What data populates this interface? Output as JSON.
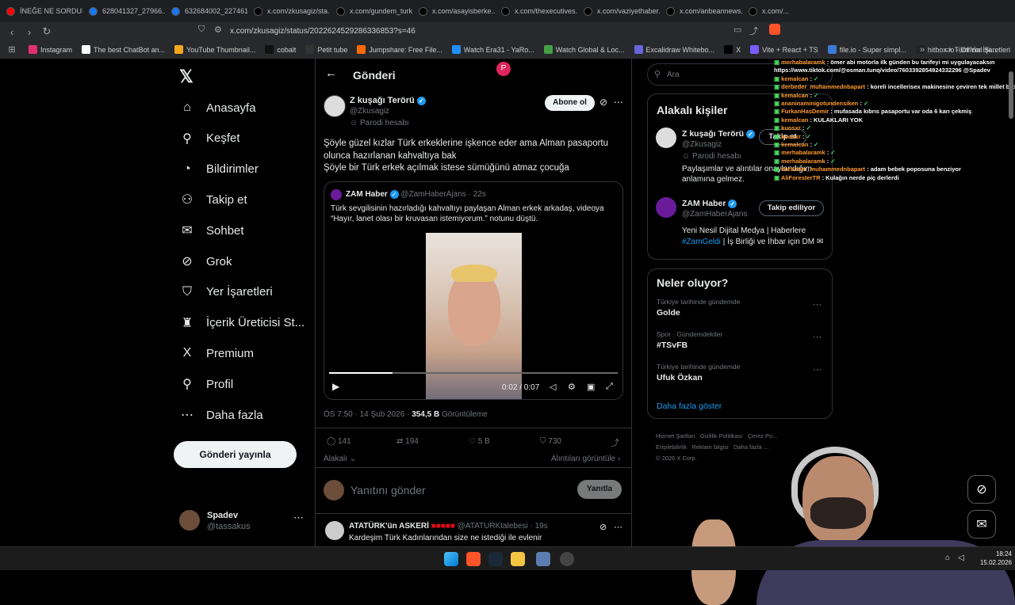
{
  "tabs": [
    {
      "label": "İNEĞE NE SORDUN",
      "color": "#ff0000"
    },
    {
      "label": "628041327_27966...",
      "color": "#1877f2"
    },
    {
      "label": "632684002_227461...",
      "color": "#1877f2"
    },
    {
      "label": "x.com/zkusagiz/sta...",
      "color": "#000000"
    },
    {
      "label": "x.com/gundem_turk...",
      "color": "#000000"
    },
    {
      "label": "x.com/asayisberke...",
      "color": "#000000"
    },
    {
      "label": "x.com/thexecutives...",
      "color": "#000000"
    },
    {
      "label": "x.com/vaziyethaber...",
      "color": "#000000"
    },
    {
      "label": "x.com/anbeannews...",
      "color": "#000000"
    },
    {
      "label": "x.com/...",
      "color": "#000000"
    }
  ],
  "address": {
    "url": "x.com/zkusagiz/status/2022624529286336853?s=46"
  },
  "bookmarks": [
    {
      "label": "Instagram",
      "color": "#e1306c"
    },
    {
      "label": "The best ChatBot an...",
      "color": "#ffffff"
    },
    {
      "label": "YouTube Thumbnail...",
      "color": "#f4a61d"
    },
    {
      "label": "cobalt",
      "color": "#111111"
    },
    {
      "label": "Petit tube",
      "color": "#333333"
    },
    {
      "label": "Jumpshare: Free File...",
      "color": "#ff6a00"
    },
    {
      "label": "Watch Era31 - YaRo...",
      "color": "#1e90ff"
    },
    {
      "label": "Watch Global & Loc...",
      "color": "#43a047"
    },
    {
      "label": "Excalidraw Whitebo...",
      "color": "#6965db"
    },
    {
      "label": "X",
      "color": "#000000"
    },
    {
      "label": "Vite + React + TS",
      "color": "#7a5cff"
    },
    {
      "label": "file.io - Super simpl...",
      "color": "#3a7bd5"
    },
    {
      "label": "hitbox.io - Official Si...",
      "color": "#222222"
    }
  ],
  "bookmarks_all": "Tüm Yer İşaretleri",
  "nav": {
    "items": [
      {
        "label": "Anasayfa",
        "icon": "home-icon",
        "glyph": "⌂"
      },
      {
        "label": "Keşfet",
        "icon": "search-icon",
        "glyph": "⚲"
      },
      {
        "label": "Bildirimler",
        "icon": "bell-icon",
        "glyph": "◔"
      },
      {
        "label": "Takip et",
        "icon": "follow-icon",
        "glyph": "⚇"
      },
      {
        "label": "Sohbet",
        "icon": "mail-icon",
        "glyph": "✉"
      },
      {
        "label": "Grok",
        "icon": "grok-icon",
        "glyph": "⊘"
      },
      {
        "label": "Yer İşaretleri",
        "icon": "bookmark-icon",
        "glyph": "⛉"
      },
      {
        "label": "İçerik Üreticisi St...",
        "icon": "creator-icon",
        "glyph": "♜"
      },
      {
        "label": "Premium",
        "icon": "x-premium-icon",
        "glyph": "X"
      },
      {
        "label": "Profil",
        "icon": "profile-icon",
        "glyph": "⚲"
      },
      {
        "label": "Daha fazla",
        "icon": "more-icon",
        "glyph": "⋯"
      }
    ],
    "post_button": "Gönderi yayınla",
    "account": {
      "name": "Spadev",
      "handle": "@tassakus"
    }
  },
  "post": {
    "header_title": "Gönderi",
    "author": {
      "name": "Z kuşağı Terörü",
      "handle": "@Zkusagiz",
      "label": "Parodi hesabı"
    },
    "follow_button": "Abone ol",
    "text_lines": [
      "Şöyle güzel kızlar Türk erkeklerine işkence eder ama Alman pasaportu olunca hazırlanan kahvaltıya bak",
      "Şöyle bir Türk erkek açılmak istese sümüğünü atmaz çocuğa"
    ],
    "quote": {
      "name": "ZAM Haber",
      "handle": "@ZamHaberAjans",
      "time": "· 22s",
      "text": "Türk sevgilisinin hazırladığı kahvaltıyı paylaşan Alman erkek arkadaş, videoya “Hayır, lanet olası bir kruvasan istemiyorum.” notunu düştü.",
      "video_time": "0:02 / 0:07",
      "progress": 0.22
    },
    "meta": {
      "time": "ÖS 7:50 · 14 Şub 2026 ·",
      "views": "354,5 B",
      "views_label": "Görüntüleme"
    },
    "stats": {
      "replies": "141",
      "reposts": "194",
      "likes": "5 B",
      "bookmarks": "730"
    },
    "relevant": "Alakalı",
    "quotes_link": "Alıntıları görüntüle",
    "reply_placeholder": "Yanıtını gönder",
    "reply_button": "Yanıtla",
    "reply": {
      "name": "ATATÜRK'ün ASKERİ",
      "handle": "@ATATURKtalebesi",
      "time": "· 19s",
      "text": "Kardeşim Türk Kadınlarından size ne istediği ile evlenir"
    }
  },
  "right": {
    "search_placeholder": "Ara",
    "related_title": "Alakalı kişiler",
    "related": [
      {
        "name": "Z kuşağı Terörü",
        "handle": "@Zkusagiz",
        "label": "Parodi hesabı",
        "bio": "Paylaşımlar ve alıntılar onaylandığım anlamına gelmez.",
        "button": "Takip et"
      },
      {
        "name": "ZAM Haber",
        "handle": "@ZamHaberAjans",
        "label": "",
        "bio": "Yeni Nesil Dijital Medya | Haberlere",
        "bio_link": "#ZamGeldi",
        "bio_rest": "| İş Birliği ve İhbar için DM",
        "button": "Takip ediliyor"
      }
    ],
    "trends_title": "Neler oluyor?",
    "trends": [
      {
        "context": "Türkiye tarihinde gündemde",
        "name": "Golde"
      },
      {
        "context": "Spor · Gündemdekiler",
        "name": "#TSvFB"
      },
      {
        "context": "Türkiye tarihinde gündemde",
        "name": "Ufuk Özkan"
      }
    ],
    "show_more": "Daha fazla göster",
    "footer": [
      "Hizmet Şartları",
      "Gizlilik Politikası",
      "Çerez Po...",
      "Erişilebilirlik",
      "Reklam bilgisi",
      "Daha fazla ...",
      "© 2026 X Corp."
    ]
  },
  "chat": [
    {
      "user": "merhabalaramk",
      "msg": "ömer abi motorla ilk günden bu tarifeyi mi uygulayacaksın"
    },
    {
      "user": "",
      "msg": "https://www.tiktok.com/@osman.tunq/video/7603392854924332296 @Spadev"
    },
    {
      "user": "kemalcan",
      "msg": "✓"
    },
    {
      "user": "derbeder_muhammednbapart",
      "msg": "koreli incellerisex makinesine çeviren tek millet bizim kızlar"
    },
    {
      "user": "kemalcan",
      "msg": "✓"
    },
    {
      "user": "ananinaminigotundensiken",
      "msg": "✓"
    },
    {
      "user": "FurkanHasDemir",
      "msg": "mufasada kıbrıs pasaportu var oda 6 karı çekmiş"
    },
    {
      "user": "kemalcan",
      "msg": "KULAKLARI YOK"
    },
    {
      "user": "kuosxr",
      "msg": "✓"
    },
    {
      "user": "kuosxr",
      "msg": "✓"
    },
    {
      "user": "kemalcan",
      "msg": "✓"
    },
    {
      "user": "merhabalaramk",
      "msg": "✓"
    },
    {
      "user": "merhabalaramk",
      "msg": "✓"
    },
    {
      "user": "derbeder_muhammednbapart",
      "msg": "adam bebek poposuna benziyor"
    },
    {
      "user": "AliForesterTR",
      "msg": "Kulağın nerde piç derlerdi"
    }
  ],
  "taskbar": {
    "time": "18:24",
    "date": "15.02.2026"
  }
}
